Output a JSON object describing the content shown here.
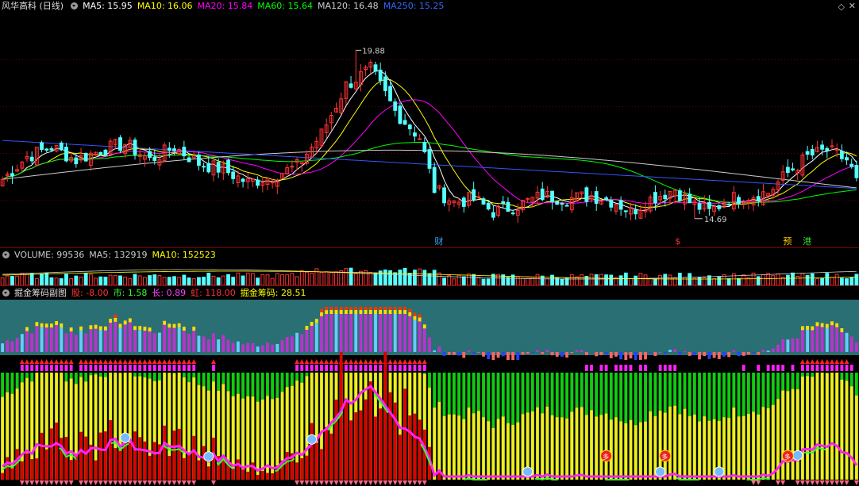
{
  "main": {
    "title": "风华高科 (日线)",
    "ma": [
      {
        "label": "MA5: 15.95",
        "color": "#ffffff"
      },
      {
        "label": "MA10: 16.06",
        "color": "#ffff00"
      },
      {
        "label": "MA20: 15.84",
        "color": "#ff00ff"
      },
      {
        "label": "MA60: 15.64",
        "color": "#00ff00"
      },
      {
        "label": "MA120: 16.48",
        "color": "#cccccc"
      },
      {
        "label": "MA250: 15.25",
        "color": "#3366ff"
      }
    ],
    "high_label": "19.88",
    "low_label": "14.69",
    "event_markers": [
      {
        "text": "财",
        "color": "#33aaff",
        "bar": 89
      },
      {
        "text": "$",
        "color": "#ff3333",
        "bar": 138
      },
      {
        "text": "预",
        "color": "#ffcc00",
        "bar": 160
      },
      {
        "text": "港",
        "color": "#33dd33",
        "bar": 164
      }
    ],
    "corner_icons": [
      "◇",
      "✕"
    ]
  },
  "volume": {
    "labels": [
      {
        "text": "VOLUME: 99536",
        "color": "#cccccc"
      },
      {
        "text": "MA5: 132919",
        "color": "#cccccc"
      },
      {
        "text": "MA10: 152523",
        "color": "#ffff00"
      }
    ]
  },
  "sub": {
    "title": "掘金筹码副图",
    "labels": [
      {
        "text": "股: -8.00",
        "color": "#ff3333"
      },
      {
        "text": "市: 1.58",
        "color": "#33ff33"
      },
      {
        "text": "长: 0.89",
        "color": "#ff44ff"
      },
      {
        "text": "虹: 118.00",
        "color": "#ff3333"
      },
      {
        "text": "掘金筹码: 28.51",
        "color": "#ffff00"
      }
    ],
    "badge_text": "多"
  },
  "chart_data": {
    "type": "candlestick",
    "n_bars": 175,
    "ylim": [
      14.0,
      20.5
    ],
    "anchors": [
      [
        0,
        15.9
      ],
      [
        5,
        16.6
      ],
      [
        10,
        16.9
      ],
      [
        15,
        16.5
      ],
      [
        20,
        16.8
      ],
      [
        25,
        17.0
      ],
      [
        30,
        16.5
      ],
      [
        35,
        16.9
      ],
      [
        40,
        16.4
      ],
      [
        45,
        16.2
      ],
      [
        50,
        15.8
      ],
      [
        55,
        16.0
      ],
      [
        60,
        16.3
      ],
      [
        65,
        17.3
      ],
      [
        70,
        18.8
      ],
      [
        75,
        19.3
      ],
      [
        80,
        18.0
      ],
      [
        85,
        17.2
      ],
      [
        88,
        15.6
      ],
      [
        92,
        15.2
      ],
      [
        96,
        15.3
      ],
      [
        100,
        14.9
      ],
      [
        105,
        15.1
      ],
      [
        110,
        15.4
      ],
      [
        115,
        15.3
      ],
      [
        120,
        15.4
      ],
      [
        125,
        15.2
      ],
      [
        128,
        14.9
      ],
      [
        132,
        15.3
      ],
      [
        137,
        15.6
      ],
      [
        140,
        15.2
      ],
      [
        144,
        14.9
      ],
      [
        148,
        15.3
      ],
      [
        152,
        15.4
      ],
      [
        156,
        15.5
      ],
      [
        160,
        16.1
      ],
      [
        164,
        16.6
      ],
      [
        168,
        16.8
      ],
      [
        172,
        16.5
      ],
      [
        174,
        15.9
      ]
    ],
    "last_close": 15.95,
    "high": 19.88,
    "low": 14.69
  }
}
